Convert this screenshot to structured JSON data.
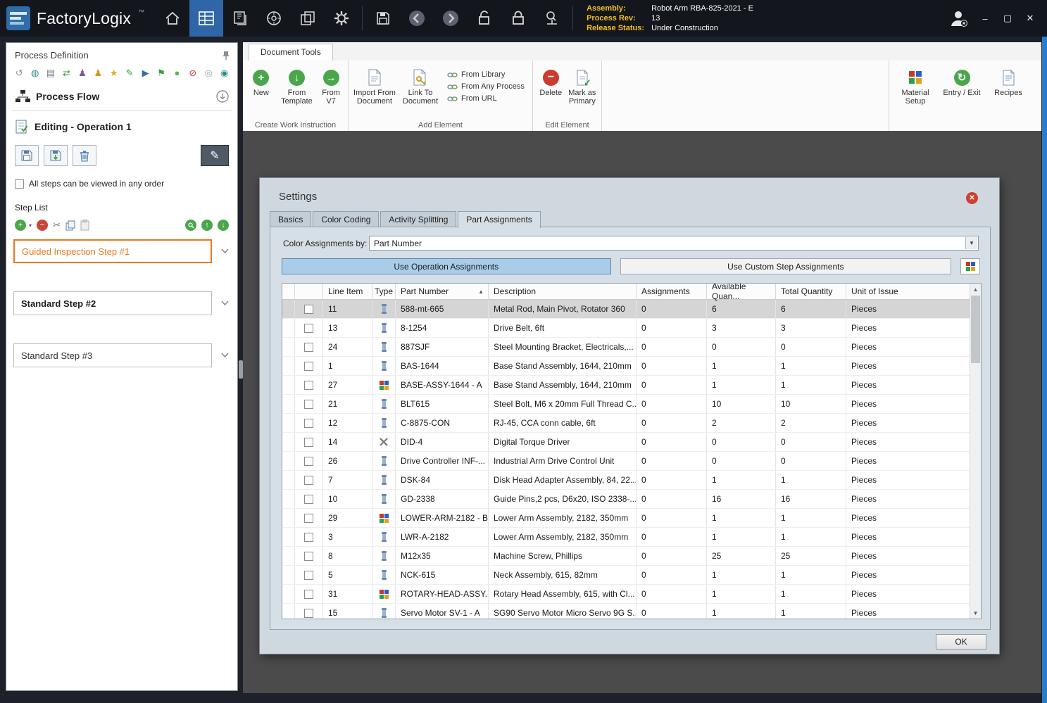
{
  "colors": {
    "titlebar_bg": "#14161e",
    "accent_blue": "#2f66a8",
    "gold_label": "#f2c11c",
    "selection_orange": "#e8791e",
    "dialog_bg": "#cfd8df",
    "primary_button_bg": "#a9cde8",
    "canvas_bg": "#4b4b4b",
    "window_frame_blue": "#2a7cc8"
  },
  "titlebar": {
    "brand": "FactoryLogix",
    "trademark": "™",
    "assembly_label": "Assembly:",
    "assembly_value": "Robot Arm RBA-825-2021 - E",
    "process_rev_label": "Process Rev:",
    "process_rev_value": "13",
    "release_status_label": "Release Status:",
    "release_status_value": "Under Construction",
    "minimize": "–",
    "maximize": "▢",
    "close": "✕"
  },
  "sidebar": {
    "title": "Process Definition",
    "toolbar_icons": [
      {
        "name": "history-icon",
        "glyph": "↺",
        "color": "#8a9096"
      },
      {
        "name": "globe-icon",
        "glyph": "◍",
        "color": "#2e8b8b"
      },
      {
        "name": "print-icon",
        "glyph": "▤",
        "color": "#777d84"
      },
      {
        "name": "sync-icon",
        "glyph": "⇄",
        "color": "#3a9d3a"
      },
      {
        "name": "user-icon",
        "glyph": "♟",
        "color": "#7a5aa0"
      },
      {
        "name": "approver-user-icon",
        "glyph": "♟",
        "color": "#c8a020"
      },
      {
        "name": "star-icon",
        "glyph": "★",
        "color": "#e0a818"
      },
      {
        "name": "edit-pencil-icon",
        "glyph": "✎",
        "color": "#3a9d3a"
      },
      {
        "name": "navigate-icon",
        "glyph": "▶",
        "color": "#3a6ab0"
      },
      {
        "name": "flag-icon",
        "glyph": "⚑",
        "color": "#3a9d3a"
      },
      {
        "name": "start-icon",
        "glyph": "●",
        "color": "#58b858"
      },
      {
        "name": "stop-icon",
        "glyph": "⊘",
        "color": "#c04040"
      },
      {
        "name": "pause-icon",
        "glyph": "◎",
        "color": "#9aa0a6"
      },
      {
        "name": "record-icon",
        "glyph": "◉",
        "color": "#2e8b8b"
      }
    ],
    "process_flow": "Process Flow",
    "editing": "Editing - Operation 1",
    "order_checkbox_label": "All steps can be viewed in any order",
    "order_checkbox_checked": false,
    "step_list_title": "Step List",
    "steps": [
      {
        "label": "Guided Inspection Step #1",
        "selected": true,
        "bold": false
      },
      {
        "label": "Standard Step #2",
        "selected": false,
        "bold": true
      },
      {
        "label": "Standard Step #3",
        "selected": false,
        "bold": false
      }
    ]
  },
  "ribbon": {
    "tab": "Document Tools",
    "create_group": {
      "label": "Create Work Instruction",
      "new": "New",
      "from_template": "From Template",
      "from_v7": "From V7"
    },
    "add_group": {
      "label": "Add Element",
      "import_from_document": "Import From Document",
      "link_to_document": "Link To Document",
      "from_library": "From Library",
      "from_any_process": "From Any Process",
      "from_url": "From URL"
    },
    "edit_group": {
      "label": "Edit Element",
      "delete": "Delete",
      "mark_as_primary": "Mark as Primary"
    },
    "right_group": {
      "material_setup": "Material Setup",
      "entry_exit": "Entry / Exit",
      "recipes": "Recipes"
    }
  },
  "dialog": {
    "title": "Settings",
    "tabs": [
      "Basics",
      "Color Coding",
      "Activity Splitting",
      "Part Assignments"
    ],
    "active_tab_index": 3,
    "color_assignments_label": "Color Assignments by:",
    "color_assignments_value": "Part Number",
    "use_operation_assignments": "Use Operation Assignments",
    "use_custom_step_assignments": "Use Custom Step Assignments",
    "ok": "OK",
    "table": {
      "headers": {
        "line_item": "Line Item",
        "type": "Type",
        "part_number": "Part Number",
        "description": "Description",
        "assignments": "Assignments",
        "available_quantity": "Available Quan...",
        "total_quantity": "Total Quantity",
        "unit_of_issue": "Unit of Issue"
      },
      "sorted_by": "Part Number",
      "sort_direction": "asc",
      "rows": [
        {
          "line_item": "11",
          "type_icon": "part-icon",
          "part_number": "588-mt-665",
          "description": "Metal Rod, Main Pivot, Rotator 360",
          "assignments": "0",
          "available": "6",
          "total": "6",
          "unit": "Pieces",
          "selected": true
        },
        {
          "line_item": "13",
          "type_icon": "part-icon",
          "part_number": "8-1254",
          "description": "Drive Belt, 6ft",
          "assignments": "0",
          "available": "3",
          "total": "3",
          "unit": "Pieces",
          "selected": false
        },
        {
          "line_item": "24",
          "type_icon": "part-icon",
          "part_number": "887SJF",
          "description": "Steel Mounting Bracket, Electricals,...",
          "assignments": "0",
          "available": "0",
          "total": "0",
          "unit": "Pieces",
          "selected": false
        },
        {
          "line_item": "1",
          "type_icon": "part-icon",
          "part_number": "BAS-1644",
          "description": "Base Stand Assembly, 1644, 210mm",
          "assignments": "0",
          "available": "1",
          "total": "1",
          "unit": "Pieces",
          "selected": false
        },
        {
          "line_item": "27",
          "type_icon": "assembly-icon",
          "part_number": "BASE-ASSY-1644 - A",
          "description": "Base Stand Assembly, 1644, 210mm",
          "assignments": "0",
          "available": "1",
          "total": "1",
          "unit": "Pieces",
          "selected": false
        },
        {
          "line_item": "21",
          "type_icon": "part-icon",
          "part_number": "BLT615",
          "description": "Steel Bolt, M6 x 20mm Full Thread C...",
          "assignments": "0",
          "available": "10",
          "total": "10",
          "unit": "Pieces",
          "selected": false
        },
        {
          "line_item": "12",
          "type_icon": "part-icon",
          "part_number": "C-8875-CON",
          "description": "RJ-45, CCA conn cable, 6ft",
          "assignments": "0",
          "available": "2",
          "total": "2",
          "unit": "Pieces",
          "selected": false
        },
        {
          "line_item": "14",
          "type_icon": "tool-icon",
          "part_number": "DID-4",
          "description": "Digital Torque Driver",
          "assignments": "0",
          "available": "0",
          "total": "0",
          "unit": "Pieces",
          "selected": false
        },
        {
          "line_item": "26",
          "type_icon": "part-icon",
          "part_number": "Drive Controller INF-...",
          "description": "Industrial Arm Drive Control Unit",
          "assignments": "0",
          "available": "0",
          "total": "0",
          "unit": "Pieces",
          "selected": false
        },
        {
          "line_item": "7",
          "type_icon": "part-icon",
          "part_number": "DSK-84",
          "description": "Disk Head Adapter Assembly, 84, 22...",
          "assignments": "0",
          "available": "1",
          "total": "1",
          "unit": "Pieces",
          "selected": false
        },
        {
          "line_item": "10",
          "type_icon": "part-icon",
          "part_number": "GD-2338",
          "description": "Guide Pins,2 pcs, D6x20, ISO 2338-...",
          "assignments": "0",
          "available": "16",
          "total": "16",
          "unit": "Pieces",
          "selected": false
        },
        {
          "line_item": "29",
          "type_icon": "assembly-icon",
          "part_number": "LOWER-ARM-2182 - B",
          "description": "Lower Arm Assembly, 2182, 350mm",
          "assignments": "0",
          "available": "1",
          "total": "1",
          "unit": "Pieces",
          "selected": false
        },
        {
          "line_item": "3",
          "type_icon": "part-icon",
          "part_number": "LWR-A-2182",
          "description": "Lower Arm Assembly, 2182, 350mm",
          "assignments": "0",
          "available": "1",
          "total": "1",
          "unit": "Pieces",
          "selected": false
        },
        {
          "line_item": "8",
          "type_icon": "part-icon",
          "part_number": "M12x35",
          "description": "Machine Screw, Phillips",
          "assignments": "0",
          "available": "25",
          "total": "25",
          "unit": "Pieces",
          "selected": false
        },
        {
          "line_item": "5",
          "type_icon": "part-icon",
          "part_number": "NCK-615",
          "description": "Neck Assembly, 615, 82mm",
          "assignments": "0",
          "available": "1",
          "total": "1",
          "unit": "Pieces",
          "selected": false
        },
        {
          "line_item": "31",
          "type_icon": "assembly-icon",
          "part_number": "ROTARY-HEAD-ASSY...",
          "description": "Rotary Head Assembly, 615, with Cl...",
          "assignments": "0",
          "available": "1",
          "total": "1",
          "unit": "Pieces",
          "selected": false
        },
        {
          "line_item": "15",
          "type_icon": "part-icon",
          "part_number": "Servo Motor SV-1 - A",
          "description": "SG90 Servo Motor Micro Servo 9G S...",
          "assignments": "0",
          "available": "1",
          "total": "1",
          "unit": "Pieces",
          "selected": false
        }
      ]
    }
  }
}
